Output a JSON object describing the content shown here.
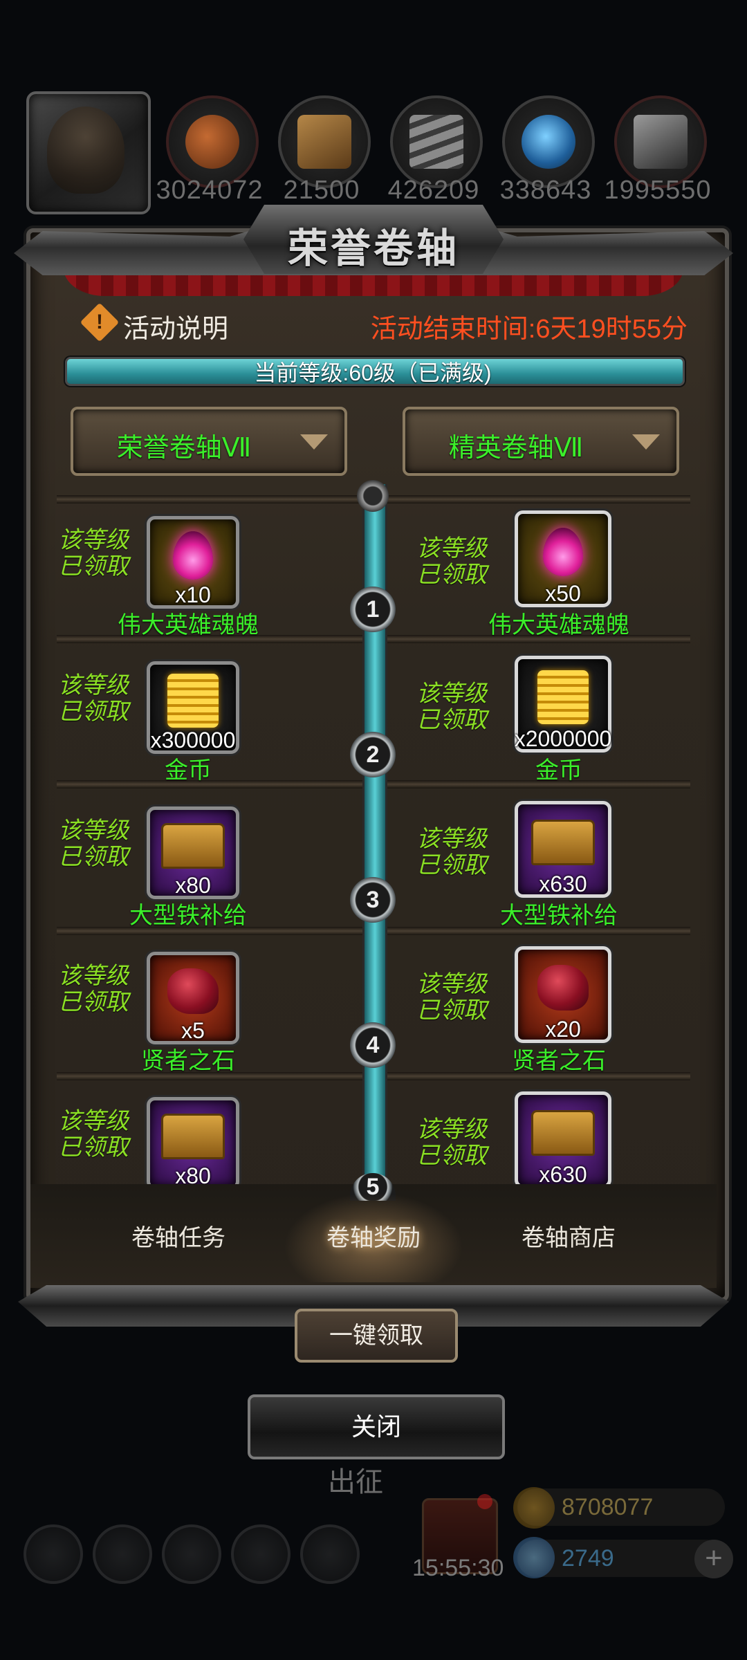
{
  "resources": [
    {
      "value": "3024072",
      "icon": "ore-icon"
    },
    {
      "value": "21500",
      "icon": "wood-icon"
    },
    {
      "value": "426209",
      "icon": "iron-icon"
    },
    {
      "value": "338643",
      "icon": "crystal-icon"
    },
    {
      "value": "1995550",
      "icon": "steel-icon"
    }
  ],
  "panel": {
    "title": "荣誉卷轴",
    "info_label": "活动说明",
    "end_time": "活动结束时间:6天19时55分",
    "level_text": "当前等级:60级（已满级)",
    "left_track": "荣誉卷轴Ⅶ",
    "right_track": "精英卷轴Ⅶ"
  },
  "rows": [
    {
      "level": "1",
      "left": {
        "status": "该等级已领取",
        "qty": "x10",
        "name": "伟大英雄魂魄",
        "icon": "soul-icon"
      },
      "right": {
        "status": "该等级已领取",
        "qty": "x50",
        "name": "伟大英雄魂魄",
        "icon": "soul-icon"
      }
    },
    {
      "level": "2",
      "left": {
        "status": "该等级已领取",
        "qty": "x300000",
        "name": "金币",
        "icon": "gold-coin-icon"
      },
      "right": {
        "status": "该等级已领取",
        "qty": "x2000000",
        "name": "金币",
        "icon": "gold-coin-icon"
      }
    },
    {
      "level": "3",
      "left": {
        "status": "该等级已领取",
        "qty": "x80",
        "name": "大型铁补给",
        "icon": "iron-chest-icon"
      },
      "right": {
        "status": "该等级已领取",
        "qty": "x630",
        "name": "大型铁补给",
        "icon": "iron-chest-icon"
      }
    },
    {
      "level": "4",
      "left": {
        "status": "该等级已领取",
        "qty": "x5",
        "name": "贤者之石",
        "icon": "sage-stone-icon"
      },
      "right": {
        "status": "该等级已领取",
        "qty": "x20",
        "name": "贤者之石",
        "icon": "sage-stone-icon"
      }
    },
    {
      "level": "5",
      "left": {
        "status": "该等级已领取",
        "qty": "x80",
        "name": "",
        "icon": "iron-chest-icon"
      },
      "right": {
        "status": "该等级已领取",
        "qty": "x630",
        "name": "",
        "icon": "iron-chest-icon"
      }
    }
  ],
  "tabs": [
    "卷轴任务",
    "卷轴奖励",
    "卷轴商店"
  ],
  "active_tab": "卷轴奖励",
  "buttons": {
    "claim_all": "一键领取",
    "close": "关闭"
  },
  "background": {
    "sortie": "出征",
    "timer": "15:55:30",
    "gold": "8708077",
    "gems": "2749"
  },
  "colors": {
    "accent_green": "#3bef2a",
    "claimed_green": "#8be024",
    "warning_red": "#ff4f20",
    "track_cyan": "#59d0d6"
  }
}
